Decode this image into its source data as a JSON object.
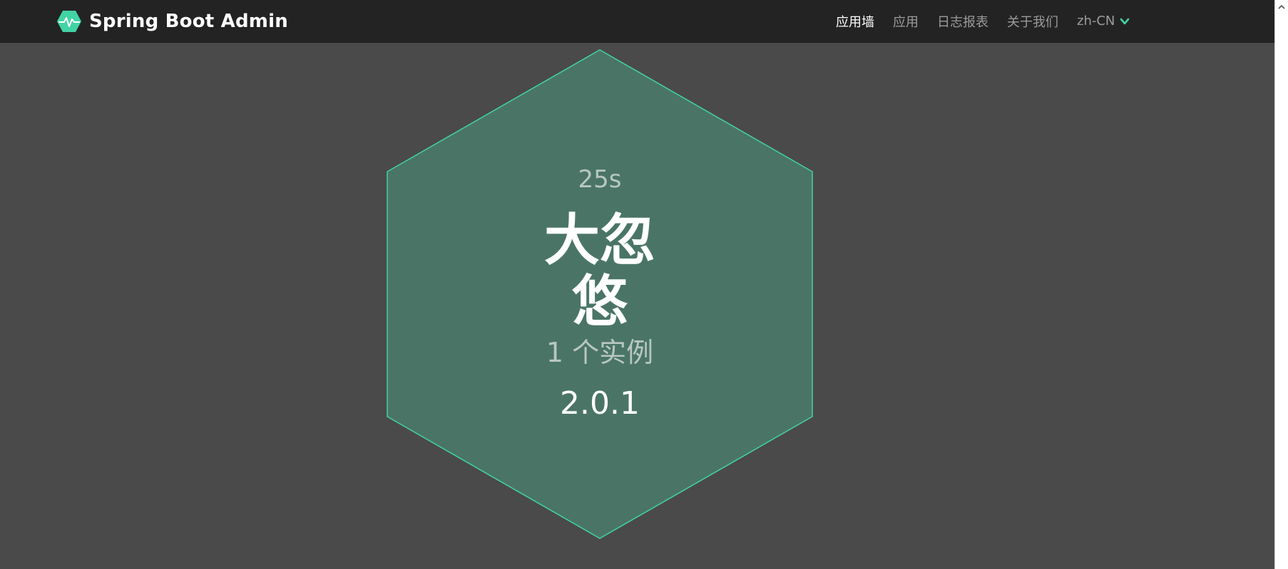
{
  "brand": {
    "title": "Spring Boot Admin",
    "icon": "hexagon-heartbeat-icon",
    "accent": "#42d3a5"
  },
  "nav": {
    "items": [
      {
        "label": "应用墙",
        "active": true
      },
      {
        "label": "应用",
        "active": false
      },
      {
        "label": "日志报表",
        "active": false
      },
      {
        "label": "关于我们",
        "active": false
      }
    ],
    "language": {
      "value": "zh-CN",
      "icon": "chevron-down-icon"
    }
  },
  "application": {
    "uptime": "25s",
    "name": "大忽悠",
    "instances": "1 个实例",
    "version": "2.0.1",
    "status_color": "#42d3a5",
    "tile_fill": "#4a7566"
  },
  "colors": {
    "navbar": "#232323",
    "background": "#4a4a4a"
  }
}
